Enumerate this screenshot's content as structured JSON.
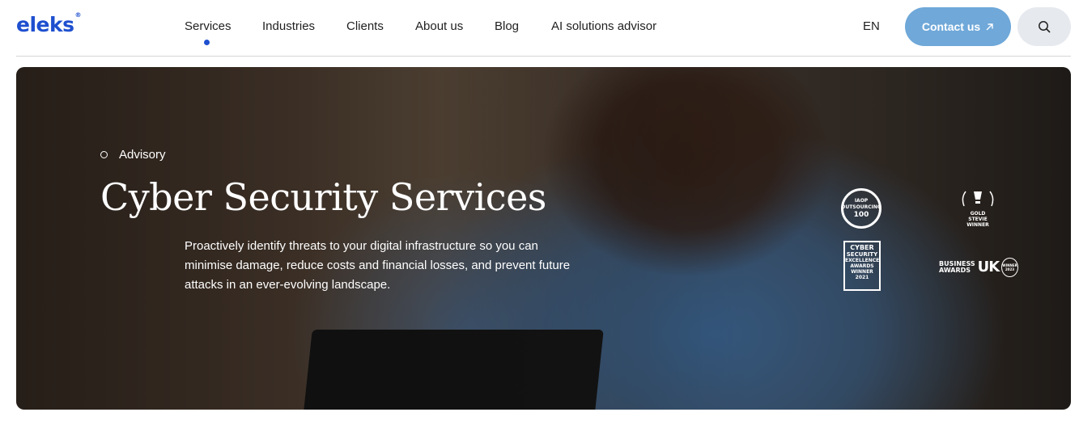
{
  "brand": {
    "logo_text": "eleks",
    "logo_mark": "®",
    "color": "#1e4fcf"
  },
  "nav": {
    "items": [
      {
        "label": "Services",
        "active": true
      },
      {
        "label": "Industries"
      },
      {
        "label": "Clients"
      },
      {
        "label": "About us"
      },
      {
        "label": "Blog"
      },
      {
        "label": "AI solutions advisor"
      }
    ]
  },
  "header": {
    "language": "EN",
    "contact_label": "Contact us",
    "contact_color": "#6fa8d9",
    "search_icon": "search-icon"
  },
  "hero": {
    "eyebrow": "Advisory",
    "title": "Cyber Security Services",
    "description": "Proactively identify threats to your digital infrastructure so you can minimise damage, reduce costs and financial losses, and prevent future attacks in an ever-evolving landscape.",
    "awards": {
      "outsourcing": {
        "top": "IAOP",
        "line1": "OUTSOURCING",
        "line2": "100"
      },
      "cyber": {
        "line1": "CYBER",
        "line2": "SECURITY",
        "line3": "EXCELLENCE",
        "line4": "AWARDS",
        "line5": "WINNER",
        "line6": "2021"
      },
      "gold": {
        "line1": "GOLD",
        "line2": "STEVIE",
        "line3": "WINNER"
      },
      "business": {
        "line1": "BUSINESS",
        "line2": "AWARDS",
        "uk": "UK",
        "ring1": "WINNER",
        "ring2": "2023"
      }
    }
  }
}
